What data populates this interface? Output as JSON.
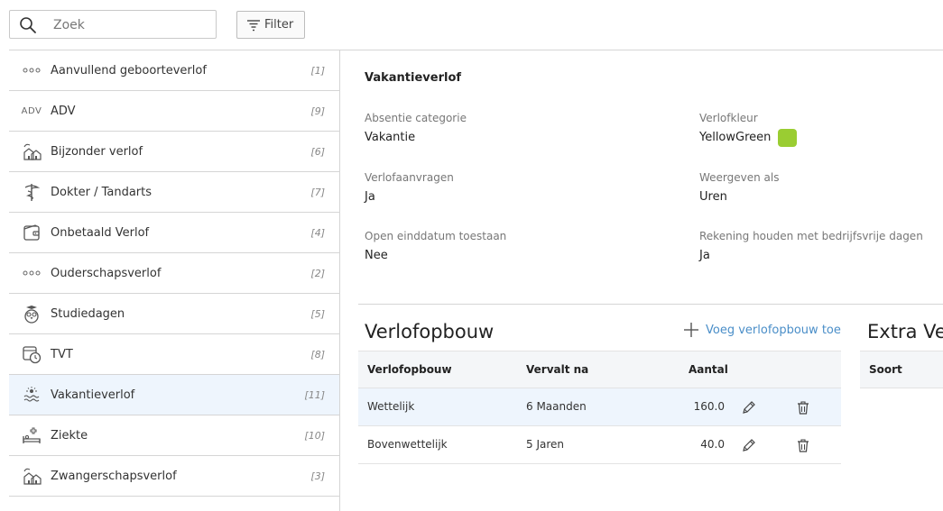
{
  "search": {
    "placeholder": "Zoek",
    "value": ""
  },
  "filter": {
    "label": "Filter"
  },
  "sidebar": {
    "items": [
      {
        "label": "Aanvullend geboorteverlof",
        "count": "[1]",
        "icon": "dots-icon"
      },
      {
        "label": "ADV",
        "count": "[9]",
        "icon": "adv-text-icon",
        "icon_text": "ADV"
      },
      {
        "label": "Bijzonder verlof",
        "count": "[6]",
        "icon": "house-icon"
      },
      {
        "label": "Dokter / Tandarts",
        "count": "[7]",
        "icon": "caduceus-icon"
      },
      {
        "label": "Onbetaald Verlof",
        "count": "[4]",
        "icon": "wallet-icon"
      },
      {
        "label": "Ouderschapsverlof",
        "count": "[2]",
        "icon": "dots-icon"
      },
      {
        "label": "Studiedagen",
        "count": "[5]",
        "icon": "owl-icon"
      },
      {
        "label": "TVT",
        "count": "[8]",
        "icon": "calendar-clock-icon"
      },
      {
        "label": "Vakantieverlof",
        "count": "[11]",
        "icon": "beach-icon",
        "active": true
      },
      {
        "label": "Ziekte",
        "count": "[10]",
        "icon": "sickbed-icon"
      },
      {
        "label": "Zwangerschapsverlof",
        "count": "[3]",
        "icon": "house-icon"
      }
    ]
  },
  "detail": {
    "title": "Vakantieverlof",
    "fields": {
      "absentie_label": "Absentie categorie",
      "absentie_value": "Vakantie",
      "kleur_label": "Verlofkleur",
      "kleur_value": "YellowGreen",
      "kleur_hex": "#9acd32",
      "aanvragen_label": "Verlofaanvragen",
      "aanvragen_value": "Ja",
      "weergeven_label": "Weergeven als",
      "weergeven_value": "Uren",
      "open_label": "Open einddatum toestaan",
      "open_value": "Nee",
      "rekening_label": "Rekening houden met bedrijfsvrije dagen",
      "rekening_value": "Ja"
    }
  },
  "opbouw": {
    "title": "Verlofopbouw",
    "add_label": "Voeg verlofopbouw toe",
    "headers": {
      "name": "Verlofopbouw",
      "vervalt": "Vervalt na",
      "aantal": "Aantal"
    },
    "rows": [
      {
        "name": "Wettelijk",
        "vervalt": "6 Maanden",
        "aantal": "160.0"
      },
      {
        "name": "Bovenwettelijk",
        "vervalt": "5 Jaren",
        "aantal": "40.0"
      }
    ]
  },
  "extra": {
    "title": "Extra Verlof",
    "header_soort": "Soort"
  },
  "colors": {
    "accent": "#4a8ec8",
    "active_row": "#eef5fd",
    "header_bg": "#f4f6f8"
  }
}
